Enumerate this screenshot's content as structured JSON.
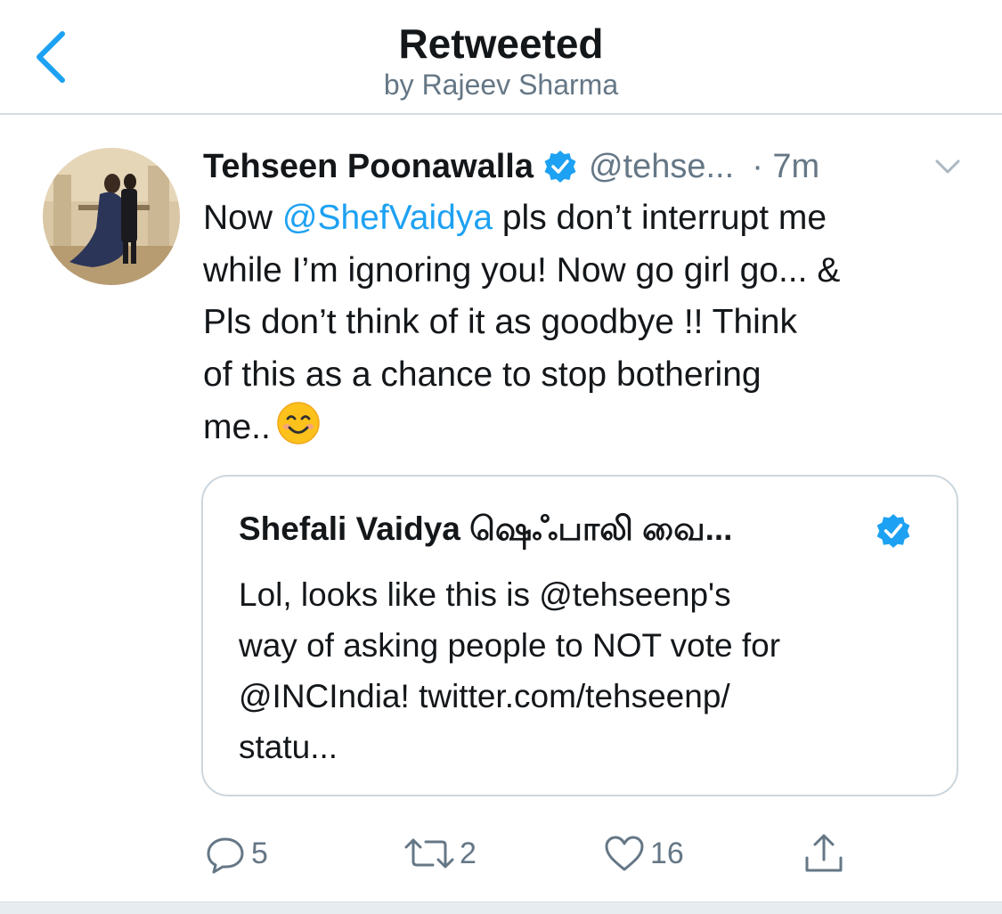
{
  "header": {
    "title": "Retweeted",
    "subtitle": "by Rajeev Sharma",
    "back_icon": "chevron-left-icon"
  },
  "tweet": {
    "author_name": "Tehseen Poonawalla",
    "handle": "@tehse...",
    "time": "· 7m",
    "verified": true,
    "text_lines": [
      [
        "Now ",
        "@ShefVaidya",
        " pls don’t interrupt me"
      ],
      "while I’m ignoring you! Now go girl go... &",
      "Pls don’t think of it as goodbye !! Think",
      "of this as a chance to stop bothering",
      "me.."
    ],
    "emoji": "smiling-face-emoji"
  },
  "quote": {
    "author_name": "Shefali Vaidya ஷெஃபாலி வை...",
    "verified": true,
    "text_lines": [
      "Lol, looks like this is @tehseenp's",
      "way of asking people to NOT vote for",
      "@INCIndia! twitter.com/tehseenp/",
      "statu..."
    ]
  },
  "actions": {
    "reply_count": "5",
    "retweet_count": "2",
    "like_count": "16"
  },
  "colors": {
    "accent": "#1da1f2",
    "secondary_text": "#657786",
    "border": "#ccd6dd"
  }
}
